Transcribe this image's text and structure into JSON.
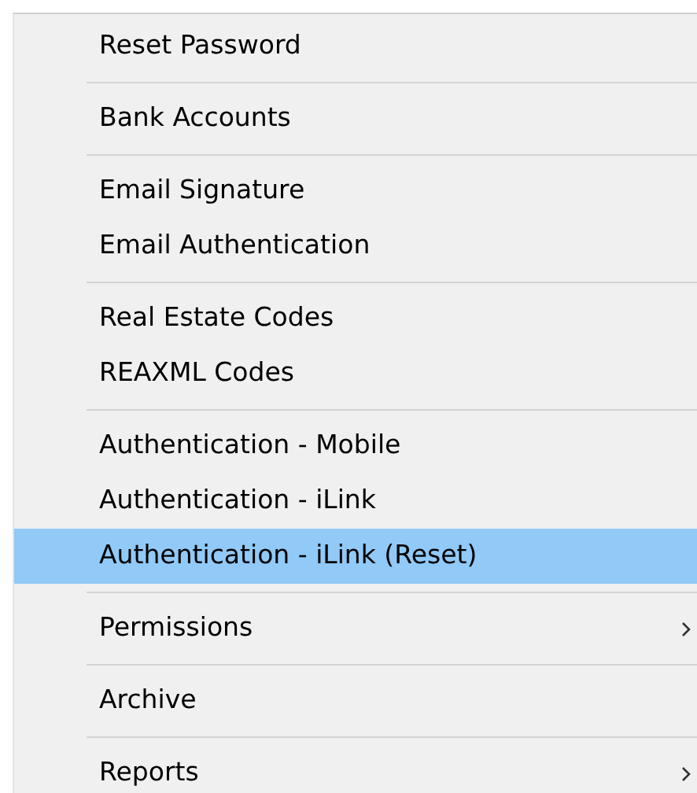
{
  "menu": {
    "groups": [
      [
        {
          "label": "Reset Password",
          "selected": false,
          "submenu": false
        }
      ],
      [
        {
          "label": "Bank Accounts",
          "selected": false,
          "submenu": false
        }
      ],
      [
        {
          "label": "Email Signature",
          "selected": false,
          "submenu": false
        },
        {
          "label": "Email Authentication",
          "selected": false,
          "submenu": false
        }
      ],
      [
        {
          "label": "Real Estate Codes",
          "selected": false,
          "submenu": false
        },
        {
          "label": "REAXML Codes",
          "selected": false,
          "submenu": false
        }
      ],
      [
        {
          "label": "Authentication - Mobile",
          "selected": false,
          "submenu": false
        },
        {
          "label": "Authentication - iLink",
          "selected": false,
          "submenu": false
        },
        {
          "label": "Authentication - iLink (Reset)",
          "selected": true,
          "submenu": false
        }
      ],
      [
        {
          "label": "Permissions",
          "selected": false,
          "submenu": true
        }
      ],
      [
        {
          "label": "Archive",
          "selected": false,
          "submenu": false
        }
      ],
      [
        {
          "label": "Reports",
          "selected": false,
          "submenu": true
        }
      ]
    ]
  }
}
